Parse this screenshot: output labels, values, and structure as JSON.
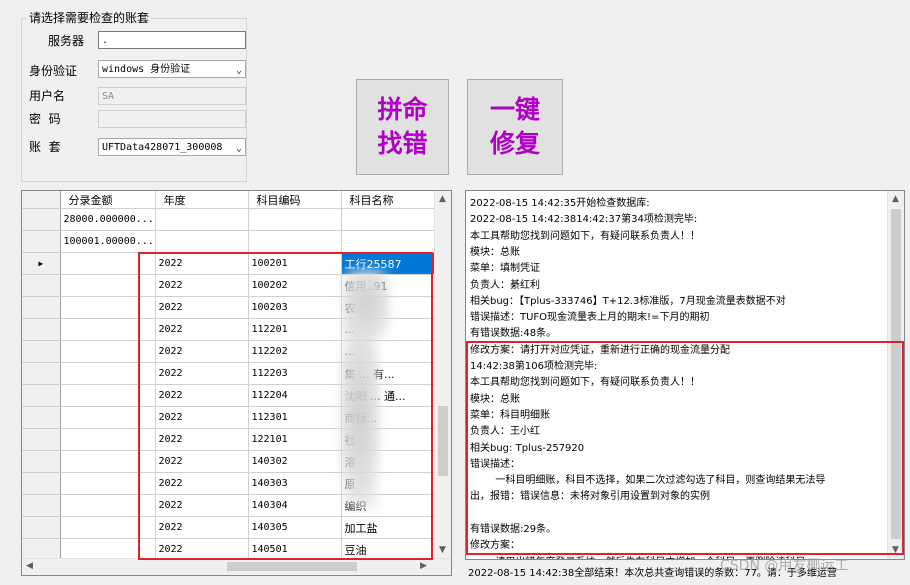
{
  "account_group": {
    "title": "请选择需要检查的账套",
    "server_label": "服务器",
    "server_value": ".",
    "auth_label": "身份验证",
    "auth_value": "windows 身份验证",
    "user_label": "用户名",
    "user_value": "SA",
    "password_label": "密  码",
    "password_value": "",
    "account_label": "账  套",
    "account_value": "UFTData428071_300008"
  },
  "buttons": {
    "find_errors_line1": "拼命",
    "find_errors_line2": "找错",
    "fix_line1": "一键",
    "fix_line2": "修复"
  },
  "grid": {
    "columns": [
      "分录金额",
      "年度",
      "科目编码",
      "科目名称"
    ],
    "rows": [
      {
        "amount": "28000.000000...",
        "year": "",
        "code": "",
        "name": ""
      },
      {
        "amount": "100001.00000...",
        "year": "",
        "code": "",
        "name": ""
      },
      {
        "amount": "",
        "year": "2022",
        "code": "100201",
        "name": "工行25587",
        "current": true
      },
      {
        "amount": "",
        "year": "2022",
        "code": "100202",
        "name": "信用..91"
      },
      {
        "amount": "",
        "year": "2022",
        "code": "100203",
        "name": "农"
      },
      {
        "amount": "",
        "year": "2022",
        "code": "112201",
        "name": "..."
      },
      {
        "amount": "",
        "year": "2022",
        "code": "112202",
        "name": "..."
      },
      {
        "amount": "",
        "year": "2022",
        "code": "112203",
        "name": "集 ... 有..."
      },
      {
        "amount": "",
        "year": "2022",
        "code": "112204",
        "name": "沈阳 ... 通..."
      },
      {
        "amount": "",
        "year": "2022",
        "code": "112301",
        "name": "商标..."
      },
      {
        "amount": "",
        "year": "2022",
        "code": "122101",
        "name": "社"
      },
      {
        "amount": "",
        "year": "2022",
        "code": "140302",
        "name": "溶"
      },
      {
        "amount": "",
        "year": "2022",
        "code": "140303",
        "name": "原"
      },
      {
        "amount": "",
        "year": "2022",
        "code": "140304",
        "name": "编织"
      },
      {
        "amount": "",
        "year": "2022",
        "code": "140305",
        "name": "加工盐"
      },
      {
        "amount": "",
        "year": "2022",
        "code": "140501",
        "name": "豆油"
      }
    ]
  },
  "log": {
    "lines": [
      "2022-08-15 14:42:35开始检查数据库:",
      "2022-08-15 14:42:3814:42:37第34项检测完毕:",
      "本工具帮助您找到问题如下，有疑问联系负责人！！",
      "模块：总账",
      "菜单：填制凭证",
      "负责人：綦红利",
      "相关bug：【Tplus-333746】T+12.3标准版，7月现金流量表数据不对",
      "错误描述：TUFO现金流量表上月的期末!=下月的期初",
      "有错误数据:48条。",
      "修改方案：请打开对应凭证，重新进行正确的现金流量分配",
      "14:42:38第106项检测完毕:",
      "本工具帮助您找到问题如下，有疑问联系负责人！！",
      "模块：总账",
      "菜单：科目明细账",
      "负责人：王小红",
      "相关bug: Tplus-257920",
      "错误描述：",
      "        一科目明细账，科目不选择，如果二次过滤勾选了科目，则查询结果无法导",
      "出，报错：错误信息：未将对象引用设置到对象的实例",
      "",
      "有错误数据:29条。",
      "修改方案：",
      "        请用出错年度登录系统，然后先在科目中增加一个科目，再删除该科目"
    ],
    "bottom_line": "2022-08-15 14:42:38全部结束！本次总共查询错误的条数：77。请：于多维运营"
  },
  "watermark": "CSDN @用友椰运工"
}
